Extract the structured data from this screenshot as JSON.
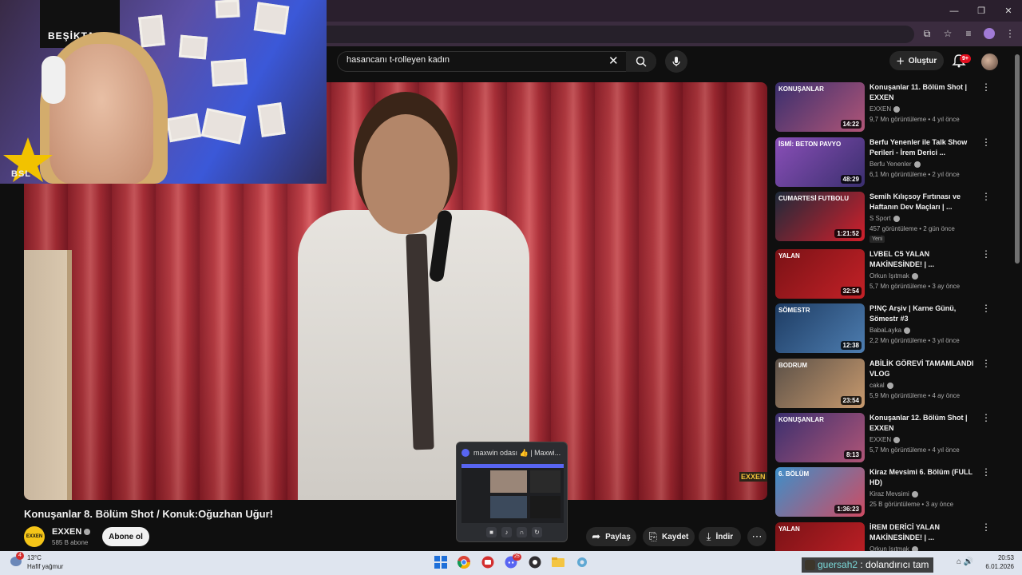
{
  "search": {
    "query": "hasancanı t-rolleyen kadın"
  },
  "header": {
    "create_label": "Oluştur",
    "notif_count": "9+"
  },
  "webcam": {
    "flag_text": "BEŞİKTAŞ",
    "logo_text": "BSL"
  },
  "player": {
    "watermark": "EXXEN"
  },
  "video": {
    "title": "Konuşanlar 8. Bölüm Shot / Konuk:Oğuzhan Uğur!",
    "channel": "EXXEN",
    "channel_avatar_text": "EXXEN",
    "subscribers": "585 B abone",
    "subscribe_label": "Abone ol",
    "share_label": "Paylaş",
    "save_label": "Kaydet",
    "download_label": "İndir"
  },
  "popup": {
    "title": "maxwin odası 👍 | Maxwi..."
  },
  "recommendations": [
    {
      "title": "Konuşanlar 11. Bölüm Shot | EXXEN",
      "channel": "EXXEN",
      "meta": "9,7 Mn görüntüleme • 4 yıl önce",
      "duration": "14:22",
      "thumb_caption": "KONUŞANLAR",
      "color1": "#3a2f6e",
      "color2": "#b05577"
    },
    {
      "title": "Berfu Yenenler ile Talk Show Perileri - İrem Derici ...",
      "channel": "Berfu Yenenler",
      "meta": "6,1 Mn görüntüleme • 2 yıl önce",
      "duration": "48:29",
      "thumb_caption": "İSMİ: BETON PAVYO",
      "color1": "#8a4fb8",
      "color2": "#3a2f6e"
    },
    {
      "title": "Semih Kılıçsoy Fırtınası ve Haftanın Dev Maçları | ...",
      "channel": "S Sport",
      "meta": "457 görüntüleme • 2 gün önce",
      "duration": "1:21:52",
      "thumb_caption": "CUMARTESİ FUTBOLU",
      "color1": "#1d2a3a",
      "color2": "#d21f2b",
      "badge": "Yeni"
    },
    {
      "title": "LVBEL C5 YALAN MAKİNESİNDE! | ...",
      "channel": "Orkun Işıtmak",
      "meta": "5,7 Mn görüntüleme • 3 ay önce",
      "duration": "32:54",
      "thumb_caption": "YALAN",
      "color1": "#7a1216",
      "color2": "#c42127"
    },
    {
      "title": "P!NÇ Arşiv | Karne Günü, Sömestr #3",
      "channel": "BabaLayka",
      "meta": "2,2 Mn görüntüleme • 3 yıl önce",
      "duration": "12:38",
      "thumb_caption": "SÖMESTR",
      "color1": "#1e3c63",
      "color2": "#4d7db0"
    },
    {
      "title": "ABİLİK GÖREVİ TAMAMLANDI VLOG",
      "channel": "cakal",
      "meta": "5,9 Mn görüntüleme • 4 ay önce",
      "duration": "23:54",
      "thumb_caption": "BODRUM",
      "color1": "#5b5047",
      "color2": "#c89a6e"
    },
    {
      "title": "Konuşanlar 12. Bölüm Shot | EXXEN",
      "channel": "EXXEN",
      "meta": "5,7 Mn görüntüleme • 4 yıl önce",
      "duration": "8:13",
      "thumb_caption": "KONUŞANLAR",
      "color1": "#3a2f6e",
      "color2": "#b05577"
    },
    {
      "title": "Kiraz Mevsimi 6. Bölüm (FULL HD)",
      "channel": "Kiraz Mevsimi",
      "meta": "25 B görüntüleme • 3 ay önce",
      "duration": "1:36:23",
      "thumb_caption": "6. BÖLÜM",
      "color1": "#3d8fc9",
      "color2": "#cf4b62"
    },
    {
      "title": "İREM DERİCİ YALAN MAKİNESİNDE! | ...",
      "channel": "Orkun Işıtmak",
      "meta": "",
      "duration": "",
      "thumb_caption": "YALAN",
      "color1": "#7a1216",
      "color2": "#c42127"
    }
  ],
  "taskbar": {
    "weather_badge": "4",
    "temp": "13°C",
    "weather_desc": "Hafif yağmur",
    "time": "20:53",
    "date": "6.01.2026",
    "popup_badge": "25"
  },
  "chat_overlay": {
    "nick": "guersah2",
    "message": " : dolandırıcı tam"
  }
}
